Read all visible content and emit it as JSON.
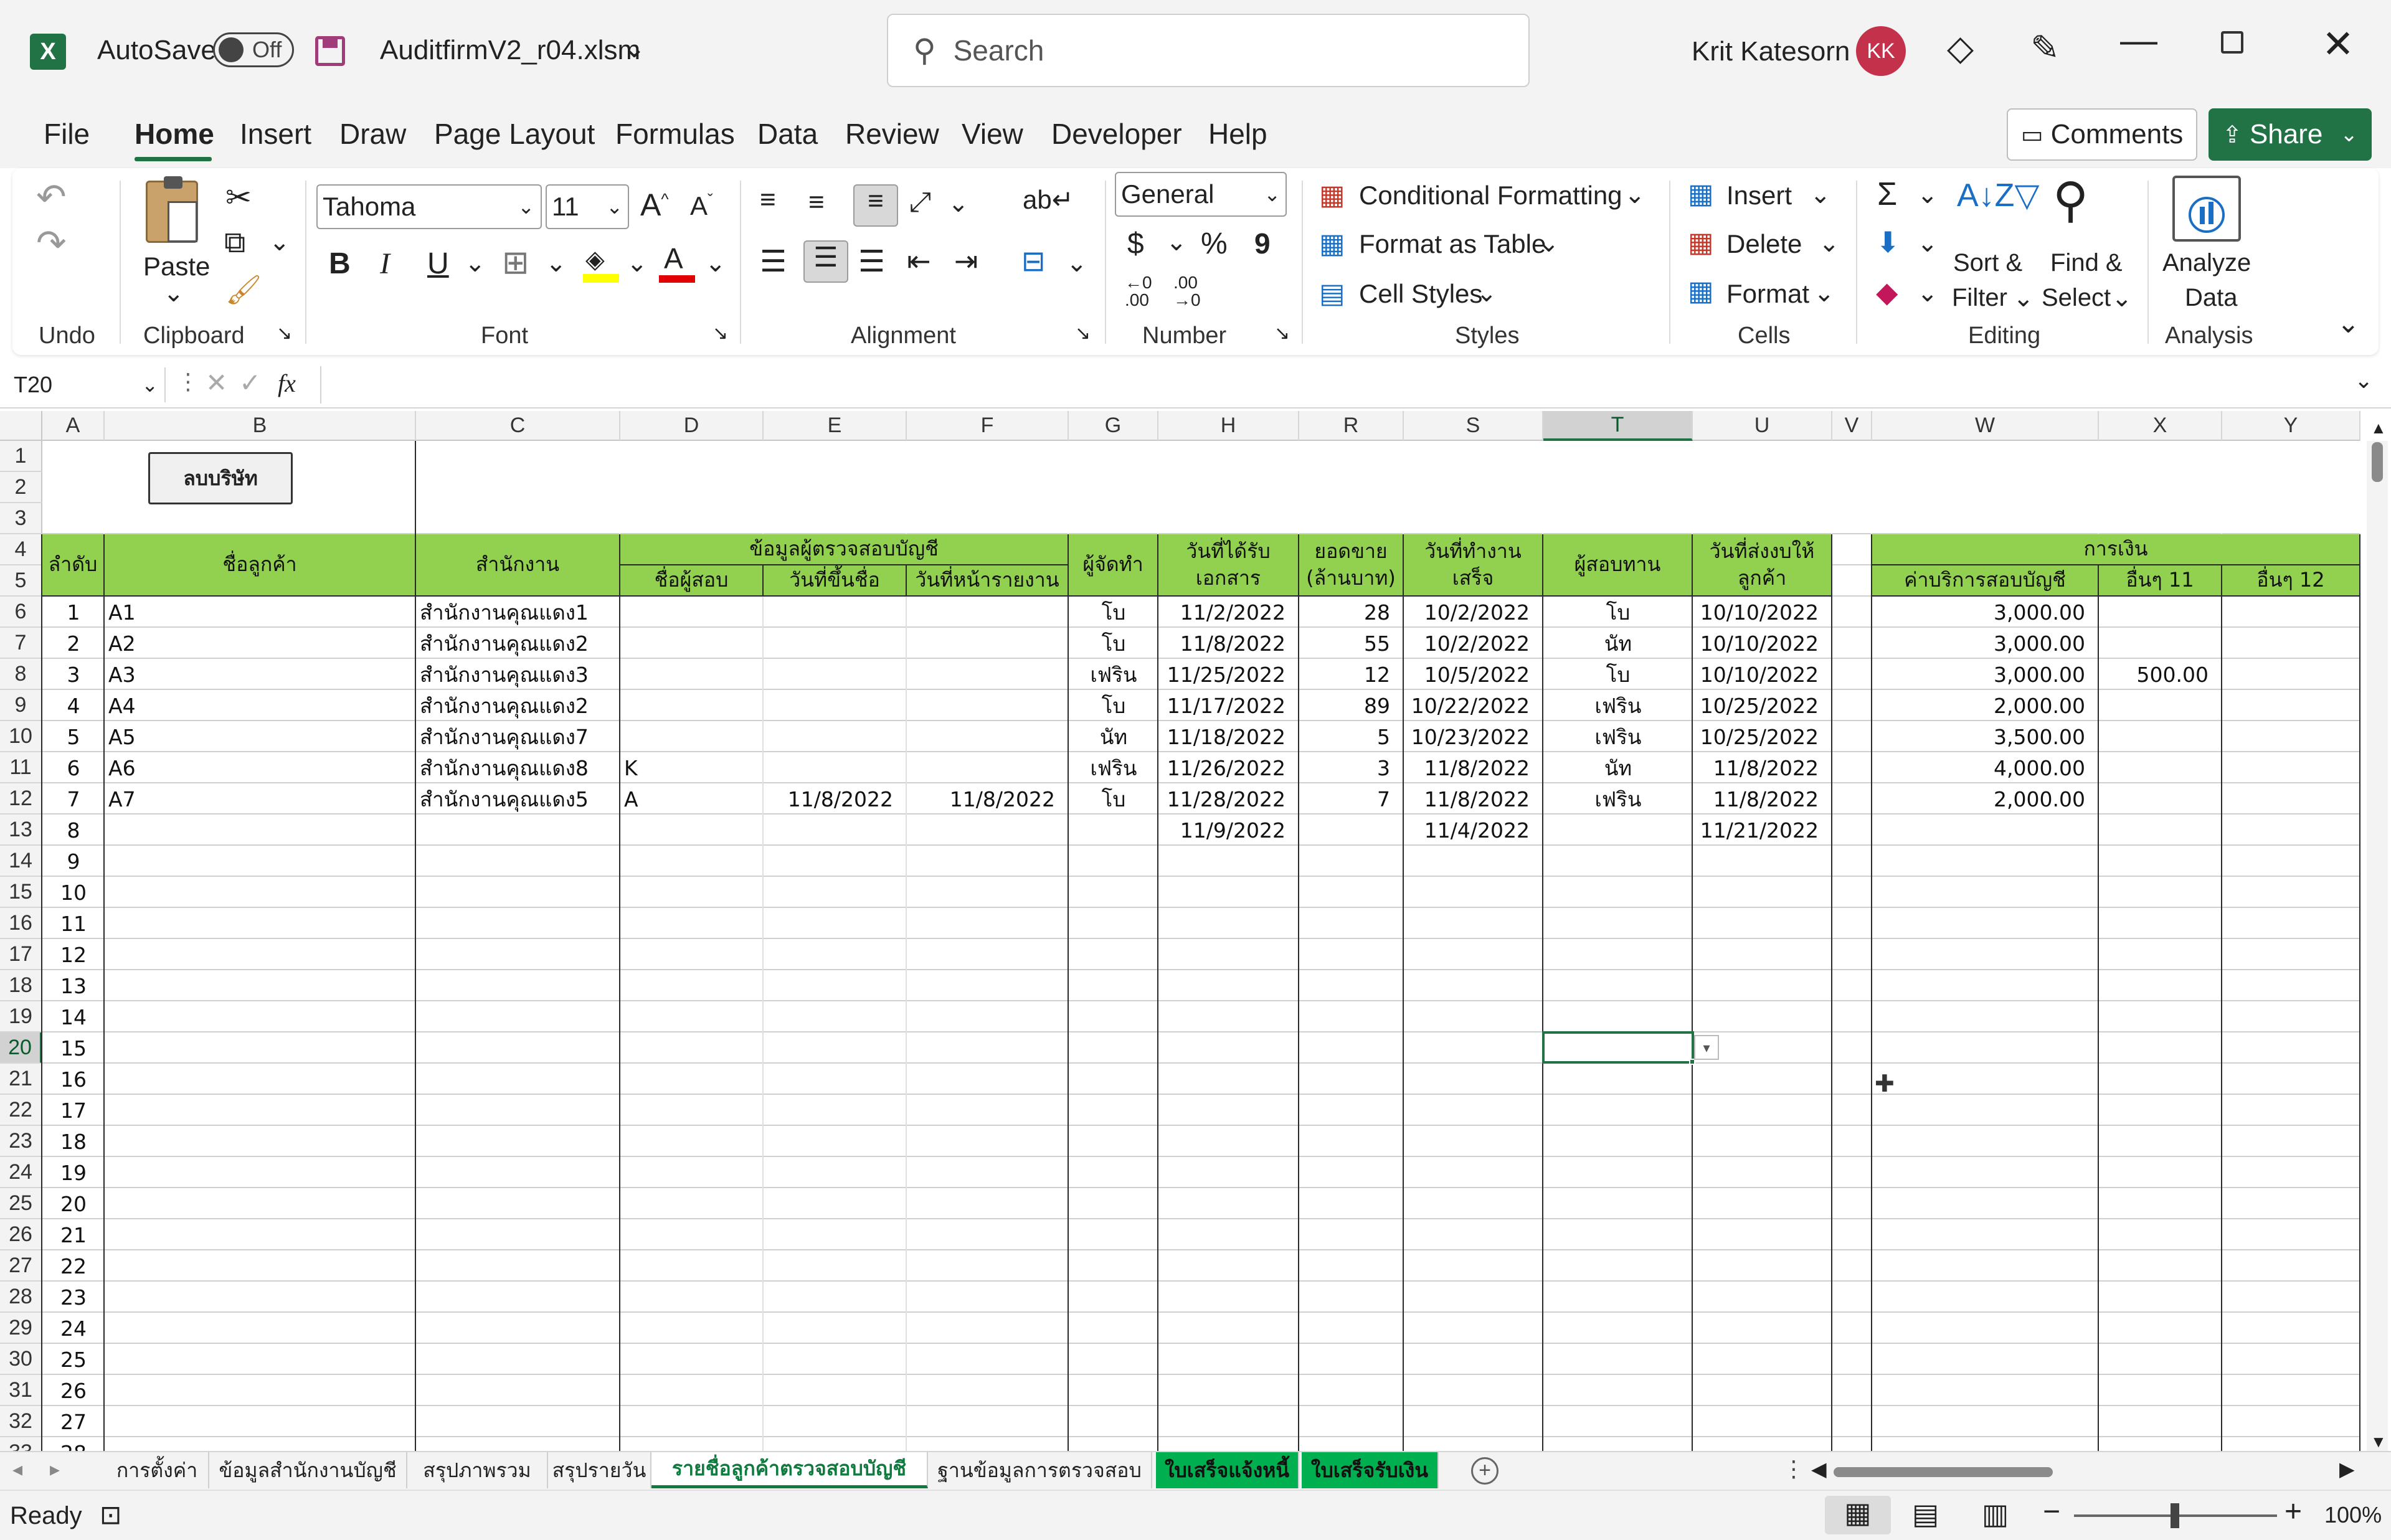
{
  "window": {
    "autosave_label": "AutoSave",
    "autosave_state": "Off",
    "filename": "AuditfirmV2_r04.xlsm",
    "search_placeholder": "Search",
    "user_name": "Krit Katesorn",
    "user_initials": "KK"
  },
  "ribbon_tabs": [
    "File",
    "Home",
    "Insert",
    "Draw",
    "Page Layout",
    "Formulas",
    "Data",
    "Review",
    "View",
    "Developer",
    "Help"
  ],
  "active_tab": "Home",
  "comments_label": "Comments",
  "share_label": "Share",
  "ribbon": {
    "undo_group": "Undo",
    "paste_label": "Paste",
    "clipboard_group": "Clipboard",
    "font_name": "Tahoma",
    "font_size": "11",
    "font_group": "Font",
    "bold": "B",
    "italic": "I",
    "underline": "U",
    "alignment_group": "Alignment",
    "number_format": "General",
    "number_group": "Number",
    "currency": "$",
    "percent": "%",
    "comma": "9",
    "conditional_formatting": "Conditional Formatting",
    "format_as_table": "Format as Table",
    "cell_styles": "Cell Styles",
    "styles_group": "Styles",
    "insert": "Insert",
    "delete": "Delete",
    "format": "Format",
    "cells_group": "Cells",
    "sort_filter_1": "Sort &",
    "sort_filter_2": "Filter",
    "find_select_1": "Find &",
    "find_select_2": "Select",
    "editing_group": "Editing",
    "analyze_1": "Analyze",
    "analyze_2": "Data",
    "analysis_group": "Analysis",
    "sigma": "Σ"
  },
  "formula_bar": {
    "name_box": "T20",
    "fx": "fx",
    "formula": ""
  },
  "columns": [
    "A",
    "B",
    "C",
    "D",
    "E",
    "F",
    "G",
    "H",
    "R",
    "S",
    "T",
    "U",
    "V",
    "W",
    "X",
    "Y"
  ],
  "row_numbers": [
    "1",
    "2",
    "3",
    "4",
    "5",
    "6",
    "7",
    "8",
    "9",
    "10",
    "11",
    "12",
    "13",
    "14",
    "15",
    "16",
    "17",
    "18",
    "19",
    "20",
    "21",
    "22",
    "23",
    "24",
    "25",
    "26",
    "27",
    "28",
    "29",
    "30",
    "31",
    "32",
    "33"
  ],
  "delete_company_button": "ลบบริษัท",
  "headers": {
    "seq": "ลำดับ",
    "customer": "ชื่อลูกค้า",
    "office": "สำนักงาน",
    "auditor_group": "ข้อมูลผู้ตรวจสอบบัญชี",
    "auditor_name": "ชื่อผู้สอบ",
    "sign_date": "วันที่ขึ้นชื่อ",
    "report_date": "วันที่หน้ารายงาน",
    "preparer": "ผู้จัดทำ",
    "doc_date_1": "วันที่ได้รับ",
    "doc_date_2": "เอกสาร",
    "sales_1": "ยอดขาย",
    "sales_2": "(ล้านบาท)",
    "done_date_1": "วันที่ทำงาน",
    "done_date_2": "เสร็จ",
    "reviewer": "ผู้สอบทาน",
    "send_date_1": "วันที่ส่งงบให้",
    "send_date_2": "ลูกค้า",
    "finance_group": "การเงิน",
    "audit_fee": "ค่าบริการสอบบัญชี",
    "other11": "อื่นๆ 11",
    "other12": "อื่นๆ 12"
  },
  "rows": [
    {
      "seq": "1",
      "customer": "A1",
      "office": "สำนักงานคุณแดง1",
      "auditor": "",
      "sign": "",
      "report": "",
      "preparer": "โบ",
      "doc": "11/2/2022",
      "sales": "28",
      "done": "10/2/2022",
      "reviewer": "โบ",
      "send": "10/10/2022",
      "fee": "3,000.00",
      "o11": "",
      "o12": ""
    },
    {
      "seq": "2",
      "customer": "A2",
      "office": "สำนักงานคุณแดง2",
      "auditor": "",
      "sign": "",
      "report": "",
      "preparer": "โบ",
      "doc": "11/8/2022",
      "sales": "55",
      "done": "10/2/2022",
      "reviewer": "นัท",
      "send": "10/10/2022",
      "fee": "3,000.00",
      "o11": "",
      "o12": ""
    },
    {
      "seq": "3",
      "customer": "A3",
      "office": "สำนักงานคุณแดง3",
      "auditor": "",
      "sign": "",
      "report": "",
      "preparer": "เฟริน",
      "doc": "11/25/2022",
      "sales": "12",
      "done": "10/5/2022",
      "reviewer": "โบ",
      "send": "10/10/2022",
      "fee": "3,000.00",
      "o11": "500.00",
      "o12": ""
    },
    {
      "seq": "4",
      "customer": "A4",
      "office": "สำนักงานคุณแดง2",
      "auditor": "",
      "sign": "",
      "report": "",
      "preparer": "โบ",
      "doc": "11/17/2022",
      "sales": "89",
      "done": "10/22/2022",
      "reviewer": "เฟริน",
      "send": "10/25/2022",
      "fee": "2,000.00",
      "o11": "",
      "o12": ""
    },
    {
      "seq": "5",
      "customer": "A5",
      "office": "สำนักงานคุณแดง7",
      "auditor": "",
      "sign": "",
      "report": "",
      "preparer": "นัท",
      "doc": "11/18/2022",
      "sales": "5",
      "done": "10/23/2022",
      "reviewer": "เฟริน",
      "send": "10/25/2022",
      "fee": "3,500.00",
      "o11": "",
      "o12": ""
    },
    {
      "seq": "6",
      "customer": "A6",
      "office": "สำนักงานคุณแดง8",
      "auditor": "K",
      "sign": "",
      "report": "",
      "preparer": "เฟริน",
      "doc": "11/26/2022",
      "sales": "3",
      "done": "11/8/2022",
      "reviewer": "นัท",
      "send": "11/8/2022",
      "fee": "4,000.00",
      "o11": "",
      "o12": ""
    },
    {
      "seq": "7",
      "customer": "A7",
      "office": "สำนักงานคุณแดง5",
      "auditor": "A",
      "sign": "11/8/2022",
      "report": "11/8/2022",
      "preparer": "โบ",
      "doc": "11/28/2022",
      "sales": "7",
      "done": "11/8/2022",
      "reviewer": "เฟริน",
      "send": "11/8/2022",
      "fee": "2,000.00",
      "o11": "",
      "o12": ""
    },
    {
      "seq": "8",
      "customer": "",
      "office": "",
      "auditor": "",
      "sign": "",
      "report": "",
      "preparer": "",
      "doc": "11/9/2022",
      "sales": "",
      "done": "11/4/2022",
      "reviewer": "",
      "send": "11/21/2022",
      "fee": "",
      "o11": "",
      "o12": ""
    },
    {
      "seq": "9"
    },
    {
      "seq": "10"
    },
    {
      "seq": "11"
    },
    {
      "seq": "12"
    },
    {
      "seq": "13"
    },
    {
      "seq": "14"
    },
    {
      "seq": "15"
    },
    {
      "seq": "16"
    },
    {
      "seq": "17"
    },
    {
      "seq": "18"
    },
    {
      "seq": "19"
    },
    {
      "seq": "20"
    },
    {
      "seq": "21"
    },
    {
      "seq": "22"
    },
    {
      "seq": "23"
    },
    {
      "seq": "24"
    },
    {
      "seq": "25"
    },
    {
      "seq": "26"
    },
    {
      "seq": "27"
    },
    {
      "seq": "28"
    }
  ],
  "sheet_tabs": [
    "การตั้งค่า",
    "ข้อมูลสำนักงานบัญชี",
    "สรุปภาพรวม",
    "สรุปรายวัน",
    "รายชื่อลูกค้าตรวจสอบบัญชี",
    "ฐานข้อมูลการตรวจสอบ",
    "ใบเสร็จแจ้งหนี้",
    "ใบเสร็จรับเงิน"
  ],
  "active_sheet": "รายชื่อลูกค้าตรวจสอบบัญชี",
  "status": {
    "ready": "Ready",
    "zoom": "100%"
  },
  "colors": {
    "excel_green": "#217346",
    "header_fill": "#92d050",
    "active_tab_green": "#0f7b3f",
    "sheet_tab_fill": "#00b050"
  }
}
